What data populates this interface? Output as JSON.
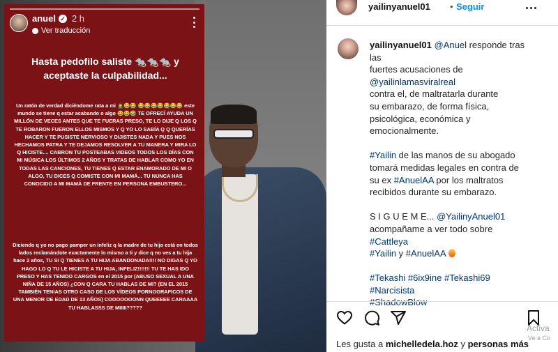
{
  "story": {
    "username": "anuel",
    "time": "2 h",
    "translate_label": "Ver traducción",
    "headline": "Hasta pedofilo saliste 🐀🐀🐀 y aceptaste la culpabilidad...",
    "paragraph1": "Un ratón de verdad diciéndome rata a mi 🤦‍♂️😂😂 😂😂😂😂😂😂😂 este mundo se tiene q estar acabando o algo 😂😂🤣 TE OFRECÍ AYUDA UN MILLÓN DE VECES ANTES QUE TE FUERAS PRESO, TE LO DIJE Q LOS Q TE ROBARON FUERON ELLOS MISMOS Y Q YO LO SABÍA Q Q QUERÍAS HACER Y TE PUSISTE NERVIOSO Y DIJISTES NADA Y PUES NOS HECHAMOS PATRA Y TE DEJAMOS RESOLVER A TU MANERA Y MIRA LO Q HICISTE.... CABRON TU POSTEABAS VIDEOS TODOS LOS DÍAS CON MI MÚSICA LOS ÚLTIMOS 2 AÑOS Y TRATAS DE HABLAR COMO YO EN TODAS LAS CANCIONES, TU TIENES Q ESTAR ENAMORADO DE MI O ALGO, TU DICES Q COMISTE CON MI MAMÁ... TU NUNCA HAS CONOCIDO A MI MAMÁ DE FRENTE EN PERSONA EMBUSTERO...",
    "paragraph2": "Diciendo q yo no pago pamper un infeliz q la madre de tu hijo está en todos lados reclamándote exactamente lo mismo a ti y dice q no ves a tu hija hace 2 años, TU SI Q TIENES A TU HIJA ABANDONADA!!!! NO DIGAS Q YO HAGO LO Q TU LE HICISTE A TU HIJA, INFELIZ!!!!!!! TU TE HAS IDO PRESO Y HAS TENIDO CARGOS en el 2015 por (ABUSO SEXUAL A UNA NIÑA DE 15 AÑOS) ¿CON Q CARA TU HABLAS DE MI? (EN EL 2015 TAMBIÉN TENIAS OTRO CASO DE LOS VÍDEOS PORNOGRAFICOS DE UNA MENOR DE EDAD DE 13 AÑOS) COOOOOOONN QUEEEEE CARAAAA TU HABLASSS DE MIIIII?????"
  },
  "post": {
    "username": "yailinyanuel01",
    "separator": "•",
    "follow_label": "Seguir",
    "caption_user": "yailinyanuel01",
    "caption_lines": [
      {
        "text": "@Anuel",
        "link": true,
        "after": " responde tras"
      },
      {
        "text": "las",
        "link": false,
        "after": ""
      },
      {
        "text": "fuertes acusaciones de",
        "link": false,
        "after": ""
      },
      {
        "text": "@yailinlamasviralreal",
        "link": true,
        "after": ""
      },
      {
        "text": "contra el, de maltratarla durante",
        "link": false,
        "after": ""
      },
      {
        "text": "su embarazo, de forma física,",
        "link": false,
        "after": ""
      },
      {
        "text": "psicológica, económica y",
        "link": false,
        "after": ""
      },
      {
        "text": "emocionalmente.",
        "link": false,
        "after": ""
      }
    ],
    "caption_block2": [
      {
        "text": "#Yailin",
        "link": true,
        "after": " de las manos de su abogado"
      },
      {
        "text": "tomará medidas legales en contra de",
        "link": false,
        "after": ""
      },
      {
        "text": "su ex ",
        "link": false,
        "after": ""
      },
      {
        "text": "por los maltratos",
        "link": false,
        "after": ""
      },
      {
        "text": "recibidos durante su embarazo.",
        "link": false,
        "after": ""
      }
    ],
    "hashtag_anuelaa": "#AnuelAA",
    "follow_line_prefix": "S I G U E M E... ",
    "follow_line_handle": "@YailinyAnuel01",
    "acompaname": "acompañame a ver todo sobre",
    "tag_cattleya": "#Cattleya",
    "tag_yailin": "#Yailin",
    "y_text": " y ",
    "tag_anuelaa2": "#AnuelAA",
    "tags_line1": "#Tekashi #6ix9ine #Tekashi69",
    "tags_line2": "#Narcisista",
    "tags_line3": "#ShadowBlow",
    "likes_prefix": "Les gusta a ",
    "likes_user": "michelledela.hoz",
    "likes_mid": " y ",
    "likes_others": "personas más"
  },
  "overlay": {
    "activate_windows": "Activa",
    "activate_sub": "Ve a Co"
  },
  "icons": [
    "verified-icon",
    "translate-icon",
    "more-icon",
    "heart-icon",
    "comment-icon",
    "share-icon",
    "bookmark-icon"
  ]
}
